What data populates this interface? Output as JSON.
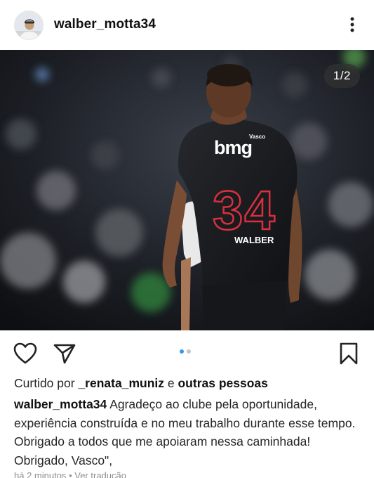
{
  "header": {
    "username": "walber_motta34",
    "avatar_icon": "profile-photo",
    "more_icon": "vertical-ellipsis-icon"
  },
  "media": {
    "counter": "1/2",
    "current_index": 1,
    "total": 2,
    "jersey_brand": "Vasco",
    "jersey_sponsor": "bmg",
    "jersey_number": "34",
    "jersey_name": "WALBER"
  },
  "actions": {
    "like_icon": "heart-icon",
    "share_icon": "send-icon",
    "save_icon": "bookmark-icon",
    "active_dot_color": "#3897f0",
    "inactive_dot_color": "#c4c4c4"
  },
  "likes": {
    "prefix": "Curtido por",
    "first_user": "_renata_muniz",
    "connector": "e",
    "others": "outras pessoas"
  },
  "caption": {
    "username": "walber_motta34",
    "text": "Agradeço ao clube pela oportunidade, experiência construída e no meu trabalho durante esse tempo. Obrigado a todos que me apoiaram nessa caminhada! Obrigado, Vasco\","
  },
  "meta": {
    "time": "há 2 minutos",
    "separator": "•",
    "translate": "Ver tradução"
  }
}
